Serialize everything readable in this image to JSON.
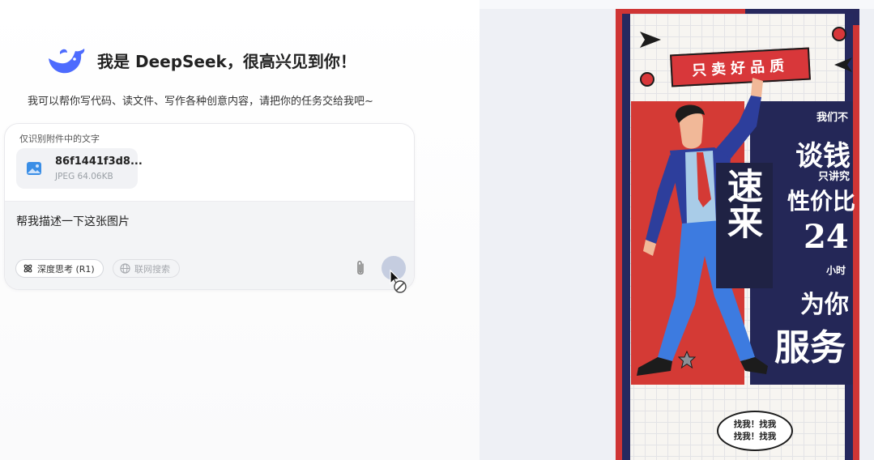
{
  "header": {
    "logo_icon": "deepseek-whale-logo",
    "title": "我是 DeepSeek，很高兴见到你！",
    "subtitle": "我可以帮你写代码、读文件、写作各种创意内容，请把你的任务交给我吧~"
  },
  "composer": {
    "attachment_hint": "仅识别附件中的文字",
    "file": {
      "name": "86f1441f3d8...",
      "meta": "JPEG 64.06KB",
      "icon": "image-file-icon"
    },
    "input_value": "帮我描述一下这张图片",
    "deep_think_label": "深度思考 (R1)",
    "web_search_label": "联网搜索",
    "attach_icon": "paperclip-icon",
    "send_icon": "send-button-disabled"
  },
  "poster": {
    "banner": "只卖好品质",
    "vertical_title": "速来",
    "line1": "我们不",
    "line2": "谈钱",
    "line3": "只讲究",
    "line4": "性价比",
    "line5": "24",
    "line6": "小时",
    "line7": "为你",
    "line8": "服务",
    "bubble_line1": "找我！找我",
    "bubble_line2": "找我！找我"
  },
  "colors": {
    "accent_blue": "#4d6bfe",
    "poster_red": "#d43a35",
    "poster_navy": "#242757"
  }
}
